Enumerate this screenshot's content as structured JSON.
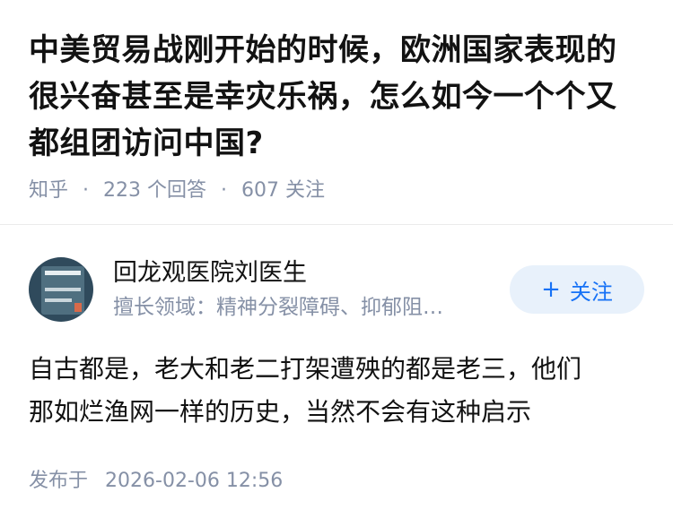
{
  "question": {
    "title": "中美贸易战刚开始的时候，欧洲国家表现的很兴奋甚至是幸灾乐祸，怎么如今一个个又都组团访问中国?",
    "source": "知乎",
    "answer_count": "223 个回答",
    "follower_count": "607 关注"
  },
  "author": {
    "name": "回龙观医院刘医生",
    "description": "擅长领域：精神分裂障碍、抑郁阻…",
    "avatar_icon": "book-cover-avatar",
    "follow_label": "关注",
    "follow_icon": "plus-icon"
  },
  "answer": {
    "line1": "自古都是，老大和老二打架遭殃的都是老三，他们",
    "line2": "那如烂渔网一样的历史，当然不会有这种启示"
  },
  "footer": {
    "published_label": "发布于",
    "published_time": "2026-02-06 12:56"
  },
  "colors": {
    "text": "#121212",
    "meta": "#8590a6",
    "accent": "#1772f6",
    "follow_bg": "#e8f1fb",
    "divider": "#ebebeb"
  }
}
